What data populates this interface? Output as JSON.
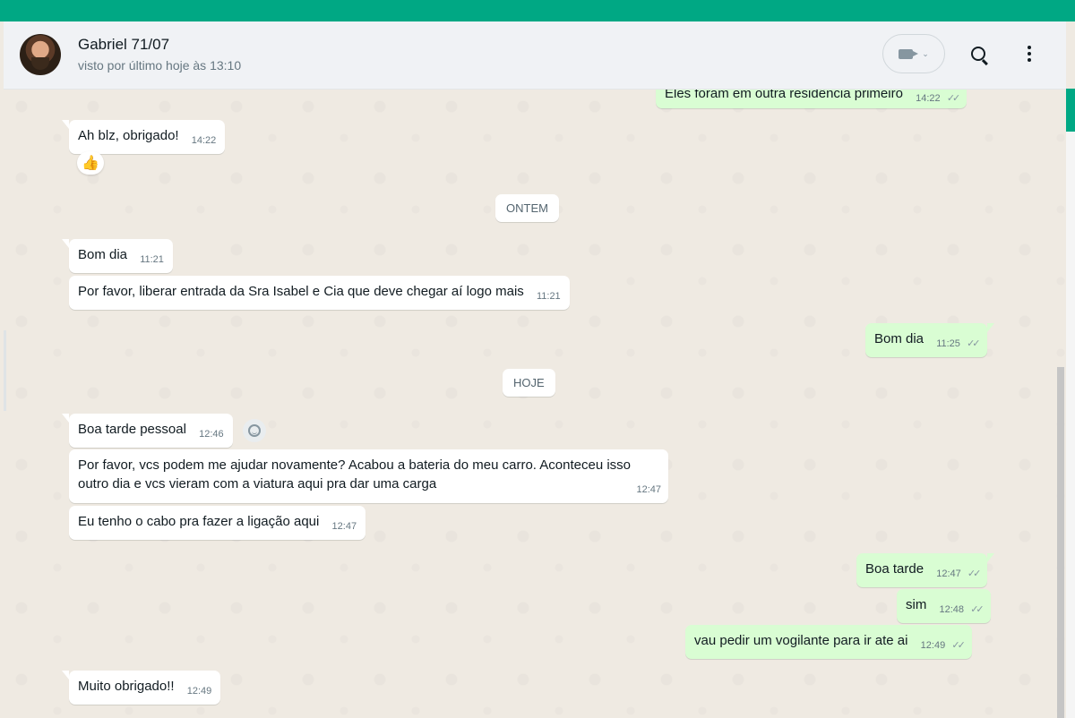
{
  "header": {
    "contact_name": "Gabriel 71/07",
    "contact_status": "visto por último hoje às 13:10"
  },
  "colors": {
    "brand": "#00a884",
    "incoming": "#ffffff",
    "outgoing": "#d9fdd3",
    "chat_bg": "#efeae2"
  },
  "icons": [
    "video-call-icon",
    "chevron-down-icon",
    "search-icon",
    "menu-icon",
    "thumbs-up-icon",
    "smiley-icon",
    "double-check-icon"
  ],
  "dates": {
    "yesterday": "ONTEM",
    "today": "HOJE"
  },
  "messages": [
    {
      "dir": "out",
      "text": "Eles foram em outra residência  primeiro",
      "time": "14:22",
      "ticks": "✓✓"
    },
    {
      "dir": "in",
      "text": "Ah blz, obrigado!",
      "time": "14:22",
      "reaction": "👍"
    },
    {
      "dir": "in",
      "text": "Bom dia",
      "time": "11:21"
    },
    {
      "dir": "in",
      "text": "Por favor, liberar entrada da Sra Isabel e Cia que deve chegar aí logo mais",
      "time": "11:21"
    },
    {
      "dir": "out",
      "text": "Bom dia",
      "time": "11:25",
      "ticks": "✓✓"
    },
    {
      "dir": "in",
      "text": "Boa tarde pessoal",
      "time": "12:46"
    },
    {
      "dir": "in",
      "text": "Por favor, vcs podem me ajudar novamente? Acabou a bateria do meu carro. Aconteceu isso outro dia e vcs vieram com a viatura aqui pra dar uma carga",
      "time": "12:47"
    },
    {
      "dir": "in",
      "text": "Eu tenho o cabo pra fazer a ligação aqui",
      "time": "12:47"
    },
    {
      "dir": "out",
      "text": "Boa tarde",
      "time": "12:47",
      "ticks": "✓✓"
    },
    {
      "dir": "out",
      "text": "sim",
      "time": "12:48",
      "ticks": "✓✓"
    },
    {
      "dir": "out",
      "text": "vau pedir um vogilante para ir ate ai",
      "time": "12:49",
      "ticks": "✓✓"
    },
    {
      "dir": "in",
      "text": "Muito obrigado!!",
      "time": "12:49"
    }
  ]
}
